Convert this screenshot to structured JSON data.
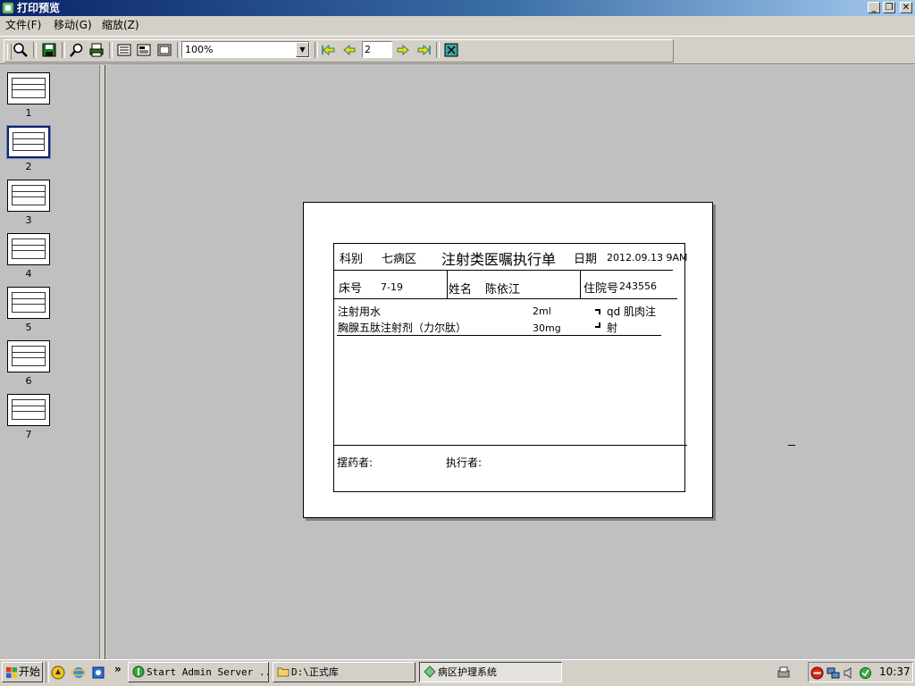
{
  "window": {
    "title": "打印预览"
  },
  "menu": {
    "file": "文件(F)",
    "move": "移动(G)",
    "zoom": "缩放(Z)"
  },
  "toolbar": {
    "zoom_value": "100%",
    "page_value": "2"
  },
  "thumbnails": [
    "1",
    "2",
    "3",
    "4",
    "5",
    "6",
    "7"
  ],
  "document": {
    "dept_label": "科别",
    "dept_value": "七病区",
    "form_title": "注射类医嘱执行单",
    "date_label": "日期",
    "date_value": "2012.09.13 9AM",
    "bed_label": "床号",
    "bed_value": "7-19",
    "name_label": "姓名",
    "name_value": "陈依江",
    "admission_label": "住院号",
    "admission_value": "243556",
    "drugs": [
      {
        "name": "注射用水",
        "dose": "2ml"
      },
      {
        "name": "胸腺五肽注射剂（力尔肽）",
        "dose": "30mg"
      }
    ],
    "usage_line1": "qd 肌肉注",
    "usage_line2": "射",
    "dispenser_label": "摆药者:",
    "executor_label": "执行者:"
  },
  "taskbar": {
    "start": "开始",
    "tasks": [
      "Start Admin Server ...",
      "D:\\正式库",
      "病区护理系统"
    ],
    "clock": "10:37"
  }
}
